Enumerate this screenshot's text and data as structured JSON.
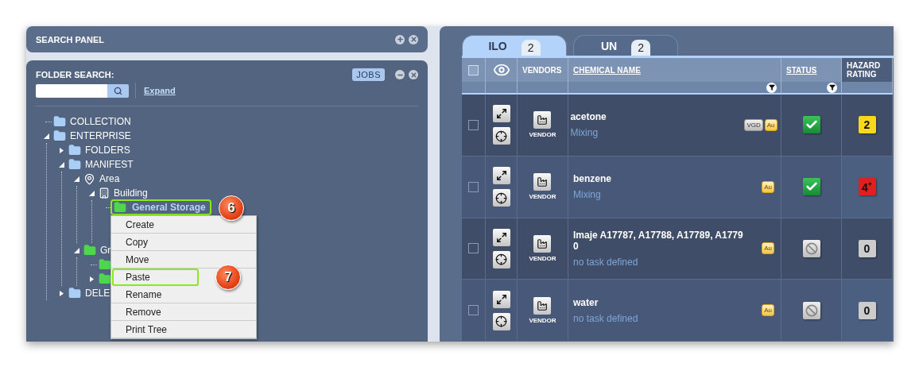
{
  "search_panel": {
    "title": "SEARCH PANEL"
  },
  "folder_panel": {
    "title": "FOLDER SEARCH:",
    "jobs_button": "JOBS",
    "expand_link": "Expand",
    "tree": [
      {
        "label": "COLLECTION",
        "kind": "folder",
        "selected": false
      },
      {
        "label": "ENTERPRISE",
        "kind": "folder",
        "selected": false,
        "expanded": true,
        "children": [
          {
            "label": "FOLDERS",
            "kind": "folder",
            "selected": false,
            "expanded": false
          },
          {
            "label": "MANIFEST",
            "kind": "folder",
            "selected": false,
            "expanded": true,
            "children": [
              {
                "label": "Area",
                "kind": "area",
                "selected": false,
                "expanded": true,
                "children": [
                  {
                    "label": "Building",
                    "kind": "building",
                    "selected": false,
                    "expanded": true,
                    "children": [
                      {
                        "label": "General Storage",
                        "kind": "green-folder",
                        "selected": true,
                        "callout": "6",
                        "context_menu": [
                          {
                            "label": "Create",
                            "highlighted": false
                          },
                          {
                            "label": "Copy",
                            "highlighted": false
                          },
                          {
                            "label": "Move",
                            "highlighted": false
                          },
                          {
                            "label": "Paste",
                            "highlighted": true,
                            "callout": "7"
                          },
                          {
                            "label": "Rename",
                            "highlighted": false
                          },
                          {
                            "label": "Remove",
                            "highlighted": false
                          },
                          {
                            "label": "Print Tree",
                            "highlighted": false
                          }
                        ]
                      }
                    ]
                  }
                ]
              },
              {
                "label": "Gr",
                "kind": "green-folder",
                "selected": false,
                "expanded": true,
                "children": [
                  {
                    "kind": "green-folder"
                  },
                  {
                    "kind": "green-folder",
                    "expanded": false
                  }
                ]
              }
            ]
          },
          {
            "label": "DELE",
            "kind": "folder",
            "selected": false,
            "expanded": false
          }
        ]
      }
    ]
  },
  "tabs": [
    {
      "label": "ILO",
      "count": "2",
      "selected": true
    },
    {
      "label": "UN",
      "count": "2",
      "selected": false
    }
  ],
  "table": {
    "select_all": {
      "checked": false
    },
    "columns": [
      {
        "label": "VENDORS",
        "kind": "plain"
      },
      {
        "label": "CHEMICAL NAME",
        "kind": "link",
        "filter": true
      },
      {
        "label": "STATUS",
        "kind": "link",
        "filter": true
      },
      {
        "label": "HAZARD RATING",
        "kind": "dark"
      }
    ],
    "rows": [
      {
        "checked": false,
        "vendor": "VENDOR",
        "name": "acetone",
        "task": "Mixing",
        "badges": [
          {
            "label": "VGD",
            "kind": "neutral"
          },
          {
            "label": "Au",
            "kind": "gold"
          }
        ],
        "approved": true,
        "hazard": {
          "text": "2",
          "color": "#f8d81c"
        }
      },
      {
        "checked": false,
        "vendor": "VENDOR",
        "name": "benzene",
        "task": "Mixing",
        "badges": [
          {
            "label": "Au",
            "kind": "gold"
          }
        ],
        "approved": true,
        "hazard": {
          "text": "4$^{+}$",
          "color": "#e0201e"
        }
      },
      {
        "checked": false,
        "vendor": "VENDOR",
        "name": "Imaje A17787, A17788, A17789, A17790",
        "task": "no task defined",
        "badges": [
          {
            "label": "Au",
            "kind": "gold"
          }
        ],
        "approved": false,
        "hazard": {
          "text": "0",
          "color": "#cccccc"
        }
      },
      {
        "checked": false,
        "vendor": "VENDOR",
        "name": "water",
        "task": "no task defined",
        "badges": [
          {
            "label": "Au",
            "kind": "gold"
          }
        ],
        "approved": false,
        "hazard": {
          "text": "0",
          "color": "#cccccc"
        }
      }
    ]
  }
}
